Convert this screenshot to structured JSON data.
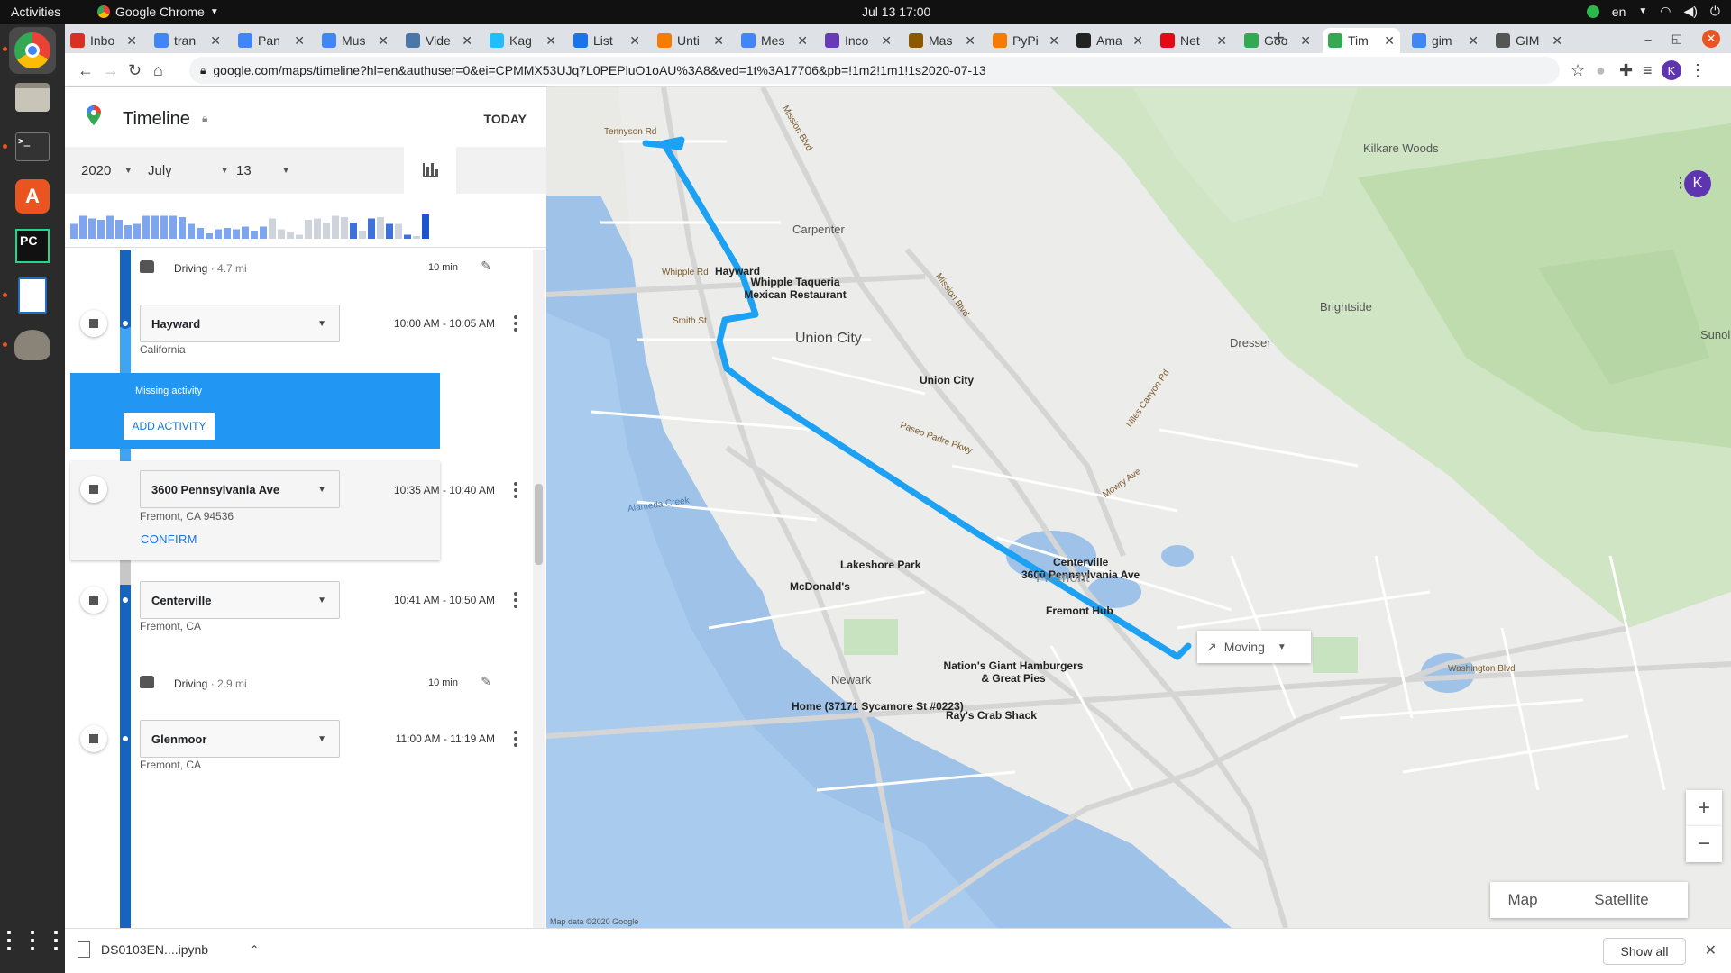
{
  "os": {
    "activities": "Activities",
    "app_name": "Google Chrome",
    "clock": "Jul 13  17:00",
    "lang": "en"
  },
  "browser": {
    "tabs": [
      {
        "title": "Inbo",
        "color": "#d93025"
      },
      {
        "title": "tran",
        "color": "#4285f4"
      },
      {
        "title": "Pan",
        "color": "#4285f4"
      },
      {
        "title": "Mus",
        "color": "#4285f4"
      },
      {
        "title": "Vide",
        "color": "#4a76a8"
      },
      {
        "title": "Kag",
        "color": "#20beff"
      },
      {
        "title": "List",
        "color": "#1a73e8"
      },
      {
        "title": "Unti",
        "color": "#f57c00"
      },
      {
        "title": "Mes",
        "color": "#4285f4"
      },
      {
        "title": "Inco",
        "color": "#673ab7"
      },
      {
        "title": "Mas",
        "color": "#8a5a00"
      },
      {
        "title": "PyPi",
        "color": "#f57c00"
      },
      {
        "title": "Ama",
        "color": "#222"
      },
      {
        "title": "Net",
        "color": "#e50914"
      },
      {
        "title": "Goo",
        "color": "#34a853"
      },
      {
        "title": "Tim",
        "color": "#34a853",
        "active": true
      },
      {
        "title": "gim",
        "color": "#4285f4"
      },
      {
        "title": "GIM",
        "color": "#555"
      }
    ],
    "url": "google.com/maps/timeline?hl=en&authuser=0&ei=CPMMX53UJq7L0PEPluO1oAU%3A8&ved=1t%3A17706&pb=!1m2!1m1!1s2020-07-13",
    "profile_initial": "K"
  },
  "timeline": {
    "title": "Timeline",
    "today": "TODAY",
    "year": "2020",
    "month": "July",
    "day": "13",
    "hist_bars": [
      0.55,
      0.85,
      0.75,
      0.7,
      0.85,
      0.7,
      0.5,
      0.55,
      0.85,
      0.85,
      0.85,
      0.85,
      0.8,
      0.55,
      0.4,
      0.2,
      0.35,
      0.4,
      0.35,
      0.45,
      0.3,
      0.45,
      0.75,
      0.35,
      0.25,
      0.15,
      0.7,
      0.75,
      0.6,
      0.85,
      0.8,
      0.6,
      0.3,
      0.75,
      0.8,
      0.55,
      0.55,
      0.15,
      0.1,
      0.9
    ],
    "entries": {
      "drive1": {
        "label": "Driving",
        "dist": "· 4.7 mi",
        "dur": "10 min"
      },
      "hayward": {
        "name": "Hayward",
        "sub": "California",
        "time": "10:00 AM - 10:05 AM"
      },
      "missing": {
        "label": "Missing activity",
        "button": "ADD ACTIVITY"
      },
      "penn": {
        "name": "3600 Pennsylvania Ave",
        "sub": "Fremont, CA 94536",
        "time": "10:35 AM - 10:40 AM",
        "confirm": "CONFIRM"
      },
      "centerville": {
        "name": "Centerville",
        "sub": "Fremont, CA",
        "time": "10:41 AM - 10:50 AM"
      },
      "drive2": {
        "label": "Driving",
        "dist": "· 2.9 mi",
        "dur": "10 min"
      },
      "glenmoor": {
        "name": "Glenmoor",
        "sub": "Fremont, CA",
        "time": "11:00 AM - 11:19 AM"
      }
    }
  },
  "map": {
    "labels": {
      "carpenter": "Carpenter",
      "hayward": "Hayward",
      "whipple": "Whipple Taqueria Mexican Restaurant",
      "union_city_big": "Union City",
      "union_city_poi": "Union City",
      "kilkare": "Kilkare Woods",
      "brightside": "Brightside",
      "dresser": "Dresser",
      "sunol": "Sunol",
      "centerville": "Centerville",
      "penn": "3600 Pennsylvania Ave",
      "fremont": "Fremont",
      "fremont_hub": "Fremont Hub",
      "lakeshore": "Lakeshore Park",
      "mcdonalds": "McDonald's",
      "nations": "Nation's Giant Hamburgers & Great Pies",
      "newark": "Newark",
      "home": "Home (37171 Sycamore St #0223)",
      "crab": "Ray's Crab Shack",
      "alameda_creek": "Alameda Creek",
      "mission_blvd": "Mission Blvd",
      "mission_blvd2": "Mission Blvd",
      "niles_canyon": "Niles Canyon Rd",
      "mowry": "Mowry Ave",
      "whipple_rd": "Whipple Rd",
      "smith_st": "Smith St",
      "tennyson": "Tennyson Rd",
      "paseo_padre": "Paseo Padre Pkwy",
      "washington": "Washington Blvd",
      "map_data": "Map data ©2020 Google"
    },
    "moving": "Moving",
    "map_btn": "Map",
    "satellite_btn": "Satellite",
    "zoom_in": "+",
    "zoom_out": "−",
    "profile_initial": "K",
    "route_color": "#1da1f2"
  },
  "downloads": {
    "file": "DS0103EN....ipynb",
    "show_all": "Show all"
  }
}
